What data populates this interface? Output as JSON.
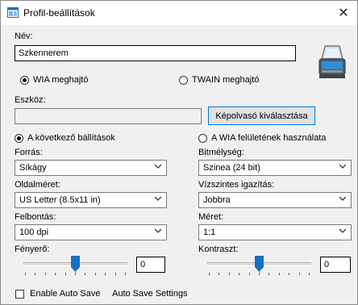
{
  "window": {
    "title": "Profil-beállítások",
    "close_glyph": "✕"
  },
  "name": {
    "label": "Név:",
    "value": "Szkennerem"
  },
  "driver": {
    "wia_label": "WIA meghajtó",
    "twain_label": "TWAIN meghajtó",
    "selected": "wia"
  },
  "device": {
    "label": "Eszköz:",
    "value": "",
    "select_button": "Képolvasó kiválasztása"
  },
  "mode": {
    "custom_label": "A következő bállítások",
    "wia_ui_label": "A WIA felületének használata",
    "selected": "custom"
  },
  "fields": {
    "source": {
      "label": "Forrás:",
      "value": "Síkágy"
    },
    "bit_depth": {
      "label": "Bitmélység:",
      "value": "Szinea (24 bit)"
    },
    "page_size": {
      "label": "Oldalméret:",
      "value": "US Letter (8.5x11 in)"
    },
    "h_align": {
      "label": "Vízszintes igazítás:",
      "value": "Jobbra"
    },
    "resolution": {
      "label": "Felbontás:",
      "value": "100 dpi"
    },
    "scale": {
      "label": "Méret:",
      "value": "1:1"
    }
  },
  "brightness": {
    "label": "Fényerő:",
    "value": "0",
    "level": 0.5
  },
  "contrast": {
    "label": "Kontraszt:",
    "value": "0",
    "level": 0.5
  },
  "auto_save": {
    "checkbox_label": "Enable Auto Save",
    "settings_link": "Auto Save Settings",
    "checked": false
  },
  "icons": {
    "title": "window-settings-icon",
    "scanner": "scanner-icon",
    "dropdown": "chevron-down-icon"
  },
  "colors": {
    "accent": "#0078d7",
    "thumb": "#1c6fc4"
  }
}
